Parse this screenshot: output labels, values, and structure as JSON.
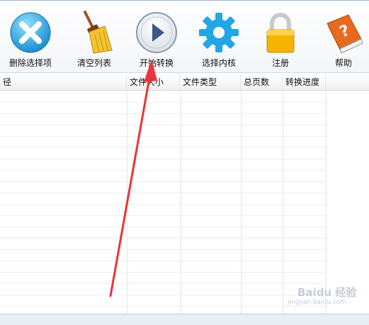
{
  "toolbar": {
    "delete_label": "删除选择项",
    "clear_label": "清空列表",
    "start_label": "开始转换",
    "kernel_label": "选择内核",
    "register_label": "注册",
    "help_label": "帮助"
  },
  "table": {
    "columns": [
      "径",
      "文件大小",
      "文件类型",
      "总页数",
      "转换进度"
    ]
  },
  "watermark": {
    "text": "Baidu 经验",
    "subtext": "jingyan.baidu.com"
  }
}
